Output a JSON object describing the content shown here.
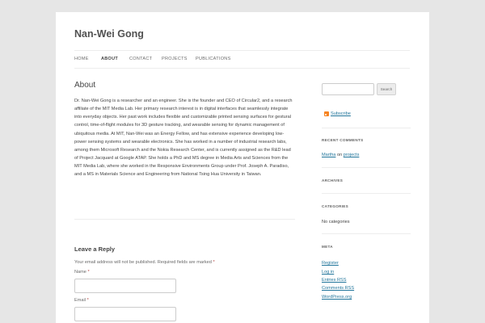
{
  "site": {
    "title": "Nan-Wei Gong"
  },
  "nav": {
    "home": "HOME",
    "about": "ABOUT",
    "contact": "CONTACT",
    "projects": "PROJECTS",
    "publications": "PUBLICATIONS"
  },
  "page": {
    "title": "About",
    "bio": "Dr. Nan-Wei Gong is a researcher and an engineer. She is the founder and CEO of Circular2, and a research affiliate of the MIT Media Lab. Her primary research interest is in digital interfaces that seamlessly integrate into everyday objects. Her past work includes flexible and customizable printed sensing surfaces for gestural control, time-of-flight modules for 3D gesture tracking, and wearable sensing for dynamic management of ubiquitous media. At MIT, Nan-Wei was an Energy Fellow, and has extensive experience developing low-power sensing systems and wearable electronics. She has worked in a number of industrial research labs, among them Microsoft Research and the Nokia Research Center, and is currently assigned as the R&D lead of Project Jacquard at Google ATAP. She holds a PhD and MS degree in Media Arts and Sciences from the MIT Media Lab, where she worked in the Responsive Environments Group under Prof. Joseph A. Paradiso, and a MS in Materials Science and Engineering from National Tsing Hua University in Taiwan."
  },
  "reply": {
    "title": "Leave a Reply",
    "note": "Your email address will not be published. Required fields are marked",
    "required_mark": "*",
    "name_label": "Name",
    "email_label": "Email"
  },
  "sidebar": {
    "search_button": "Search",
    "subscribe": "Subscribe",
    "recent_comments": {
      "title": "RECENT COMMENTS",
      "author": "Martha",
      "on": "on",
      "post": "projects"
    },
    "archives": {
      "title": "ARCHIVES"
    },
    "categories": {
      "title": "CATEGORIES",
      "text": "No categories"
    },
    "meta": {
      "title": "META",
      "links": [
        "Register",
        "Log in",
        "Entries RSS",
        "Comments RSS",
        "WordPress.org"
      ]
    }
  },
  "colors": {
    "link": "#21759b",
    "required": "#b94a48",
    "background": "#e6e6e6"
  }
}
